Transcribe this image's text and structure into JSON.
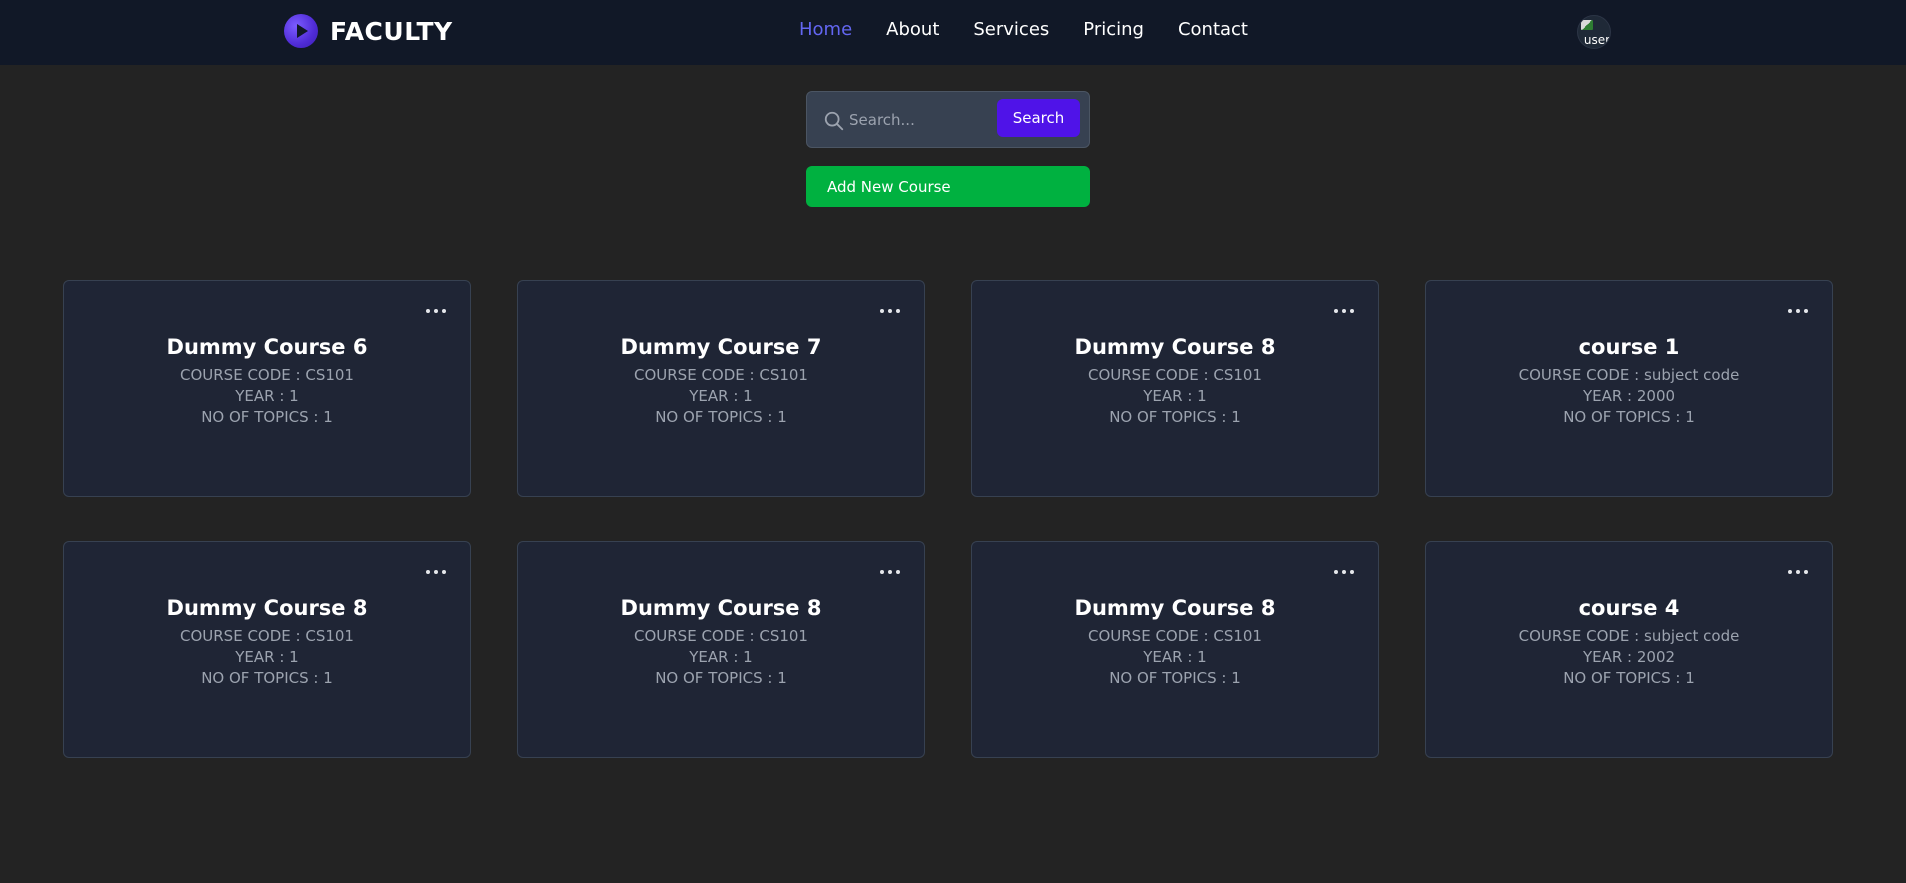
{
  "brand": {
    "name": "FACULTY",
    "logo_icon": "play-circle-icon"
  },
  "nav": {
    "links": [
      "Home",
      "About",
      "Services",
      "Pricing",
      "Contact"
    ],
    "active": "Home",
    "active_color": "#6366f1"
  },
  "avatar": {
    "alt_text": "user"
  },
  "search": {
    "placeholder": "Search...",
    "value": "",
    "button_label": "Search"
  },
  "actions": {
    "add_course_label": "Add New Course"
  },
  "colors": {
    "page_bg": "#232323",
    "navbar_bg": "#111827",
    "card_bg": "#1f2535",
    "search_button": "#4f13e8",
    "add_button": "#00b140"
  },
  "courses": [
    {
      "title": "Dummy Course 6",
      "code": "COURSE CODE : CS101",
      "year": "YEAR : 1",
      "topics": "NO OF TOPICS : 1"
    },
    {
      "title": "Dummy Course 7",
      "code": "COURSE CODE : CS101",
      "year": "YEAR : 1",
      "topics": "NO OF TOPICS : 1"
    },
    {
      "title": "Dummy Course 8",
      "code": "COURSE CODE : CS101",
      "year": "YEAR : 1",
      "topics": "NO OF TOPICS : 1"
    },
    {
      "title": "course 1",
      "code": "COURSE CODE : subject code",
      "year": "YEAR : 2000",
      "topics": "NO OF TOPICS : 1"
    },
    {
      "title": "Dummy Course 8",
      "code": "COURSE CODE : CS101",
      "year": "YEAR : 1",
      "topics": "NO OF TOPICS : 1"
    },
    {
      "title": "Dummy Course 8",
      "code": "COURSE CODE : CS101",
      "year": "YEAR : 1",
      "topics": "NO OF TOPICS : 1"
    },
    {
      "title": "Dummy Course 8",
      "code": "COURSE CODE : CS101",
      "year": "YEAR : 1",
      "topics": "NO OF TOPICS : 1"
    },
    {
      "title": "course 4",
      "code": "COURSE CODE : subject code",
      "year": "YEAR : 2002",
      "topics": "NO OF TOPICS : 1"
    }
  ]
}
